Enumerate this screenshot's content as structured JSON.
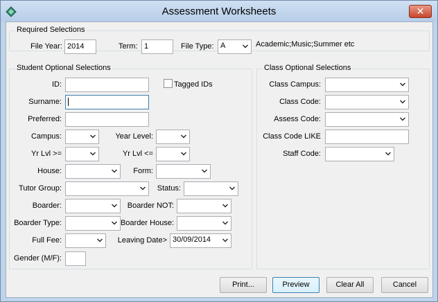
{
  "window": {
    "title": "Assessment Worksheets",
    "close_glyph": "✕"
  },
  "required": {
    "heading": "Required Selections",
    "file_year_label": "File Year:",
    "file_year_value": "2014",
    "term_label": "Term:",
    "term_value": "1",
    "file_type_label": "File Type:",
    "file_type_value": "A",
    "file_type_hint": "Academic;Music;Summer etc"
  },
  "student": {
    "heading": "Student Optional Selections",
    "id_label": "ID:",
    "tagged_ids_label": "Tagged IDs",
    "surname_label": "Surname:",
    "preferred_label": "Preferred:",
    "campus_label": "Campus:",
    "year_level_label": "Year Level:",
    "yr_lvl_ge_label": "Yr Lvl >=",
    "yr_lvl_le_label": "Yr Lvl <=",
    "house_label": "House:",
    "form_label": "Form:",
    "tutor_group_label": "Tutor Group:",
    "status_label": "Status:",
    "boarder_label": "Boarder:",
    "boarder_not_label": "Boarder NOT:",
    "boarder_type_label": "Boarder Type:",
    "boarder_house_label": "Boarder House:",
    "full_fee_label": "Full Fee:",
    "leaving_date_label": "Leaving Date>",
    "leaving_date_value": "30/09/2014",
    "gender_label": "Gender (M/F):"
  },
  "class": {
    "heading": "Class Optional Selections",
    "campus_label": "Class Campus:",
    "code_label": "Class Code:",
    "assess_code_label": "Assess Code:",
    "code_like_label": "Class Code LIKE",
    "staff_code_label": "Staff Code:"
  },
  "buttons": {
    "print": "Print...",
    "preview": "Preview",
    "clear_all": "Clear All",
    "cancel": "Cancel"
  },
  "icons": {
    "app": "diamond-app-icon",
    "dropdown": "chevron-down-icon",
    "close": "close-icon"
  }
}
